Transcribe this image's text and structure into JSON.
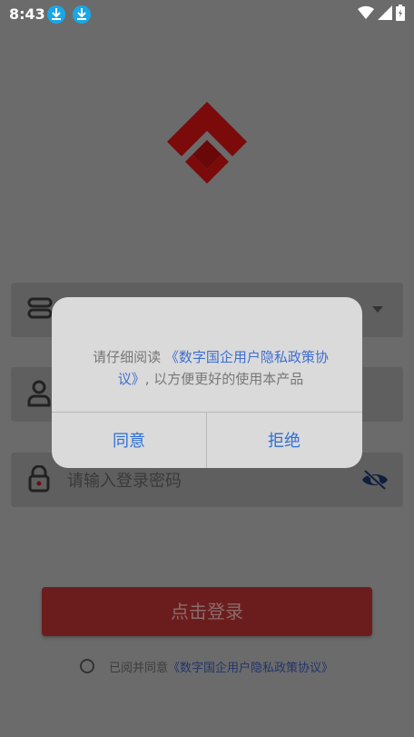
{
  "status": {
    "time": "8:43"
  },
  "form": {
    "server_placeholder": "",
    "username_placeholder": "",
    "password_placeholder": "请输入登录密码"
  },
  "login": {
    "button_label": "点击登录"
  },
  "agreement": {
    "prefix": "已阅并同意",
    "link": "《数字国企用户隐私政策协议》"
  },
  "dialog": {
    "message_prefix": "请仔细阅读",
    "message_link": "《数字国企用户隐私政策协议》",
    "message_suffix": ", 以方便更好的使用本产品",
    "agree_label": "同意",
    "reject_label": "拒绝"
  },
  "colors": {
    "brand": "#7b0a0a",
    "link": "#3f6ed0",
    "dialog_bg": "#dadada"
  }
}
